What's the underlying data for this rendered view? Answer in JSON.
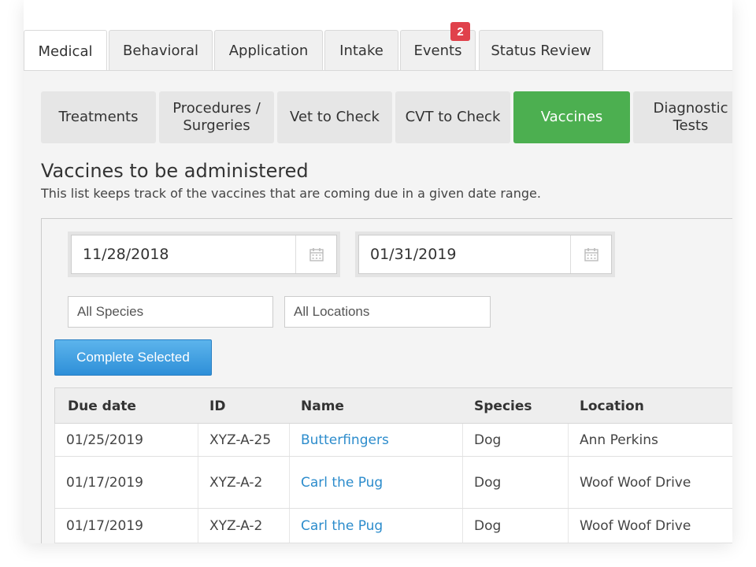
{
  "tabs": [
    {
      "label": "Medical",
      "active": true
    },
    {
      "label": "Behavioral"
    },
    {
      "label": "Application"
    },
    {
      "label": "Intake"
    },
    {
      "label": "Events",
      "badge": "2"
    },
    {
      "label": "Status Review"
    }
  ],
  "subtabs": [
    {
      "line1": "Treatments",
      "line2": ""
    },
    {
      "line1": "Procedures /",
      "line2": "Surgeries"
    },
    {
      "line1": "Vet to Check",
      "line2": ""
    },
    {
      "line1": "CVT to Check",
      "line2": ""
    },
    {
      "line1": "Vaccines",
      "line2": "",
      "active": true
    },
    {
      "line1": "Diagnostic",
      "line2": "Tests"
    }
  ],
  "section": {
    "title": "Vaccines to be administered",
    "description": "This list keeps track of the vaccines that are coming due in a given date range."
  },
  "filters": {
    "start_date": "11/28/2018",
    "end_date": "01/31/2019",
    "species": "All Species",
    "locations": "All Locations",
    "complete_button": "Complete Selected"
  },
  "table": {
    "headers": [
      "Due date",
      "ID",
      "Name",
      "Species",
      "Location"
    ],
    "rows": [
      {
        "due": "01/25/2019",
        "id": "XYZ-A-25",
        "name": "Butterfingers",
        "species": "Dog",
        "location": "Ann Perkins"
      },
      {
        "due": "01/17/2019",
        "id": "XYZ-A-2",
        "name": "Carl the Pug",
        "species": "Dog",
        "location": "Woof Woof Drive"
      },
      {
        "due": "01/17/2019",
        "id": "XYZ-A-2",
        "name": "Carl the Pug",
        "species": "Dog",
        "location": "Woof Woof Drive"
      }
    ]
  },
  "colors": {
    "active_subtab": "#4caf50",
    "badge": "#e0414b",
    "link": "#2c8ccc",
    "button": "#2e8fd8"
  }
}
